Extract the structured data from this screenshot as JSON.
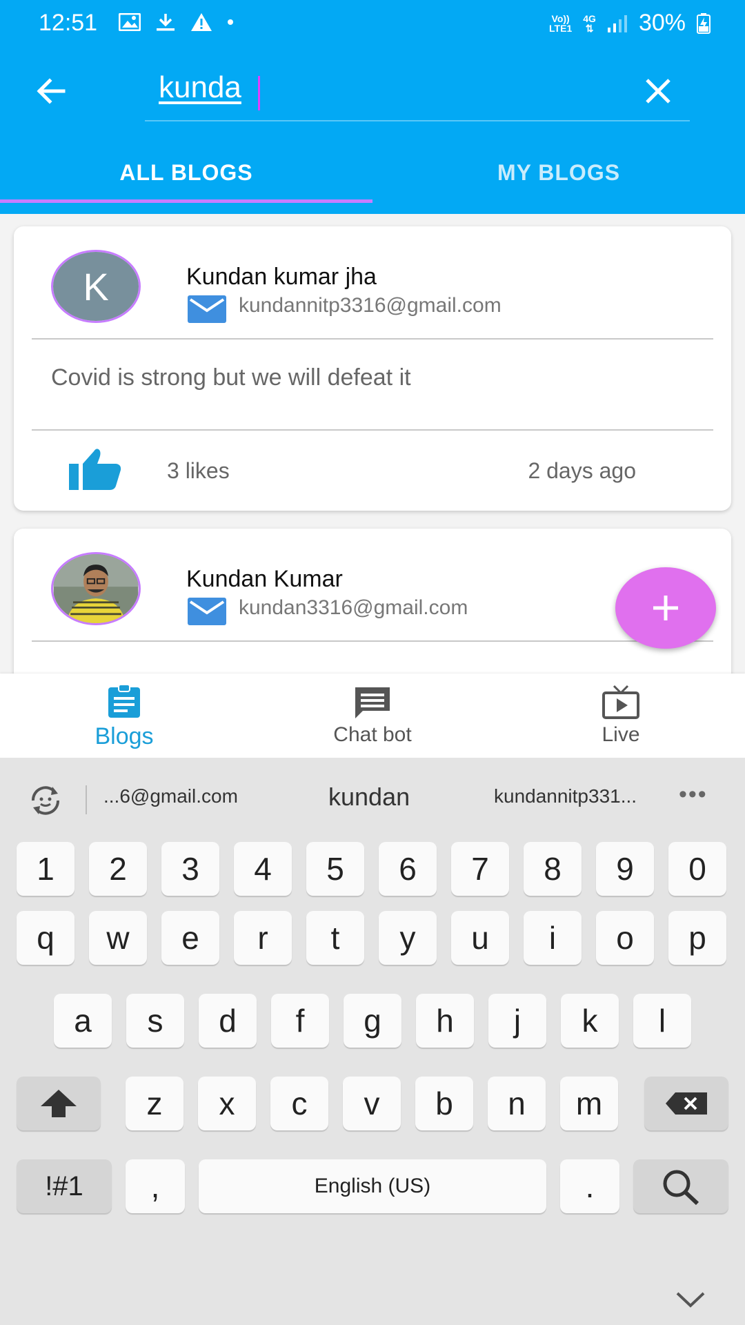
{
  "status_bar": {
    "time": "12:51",
    "battery": "30%",
    "network_top": "Vo))\nLTE1",
    "network_label": "4G"
  },
  "search": {
    "value": "kunda",
    "placeholder": ""
  },
  "tabs": [
    {
      "label": "ALL BLOGS",
      "active": true
    },
    {
      "label": "MY BLOGS",
      "active": false
    }
  ],
  "blogs": [
    {
      "avatar_letter": "K",
      "author": "Kundan kumar jha",
      "email": "kundannitp3316@gmail.com",
      "text": "Covid is strong but we will defeat it",
      "likes": "3 likes",
      "time": "2 days ago"
    },
    {
      "author": "Kundan Kumar",
      "email": "kundan3316@gmail.com"
    }
  ],
  "bottom_nav": [
    {
      "label": "Blogs",
      "icon": "assignment-icon",
      "active": true
    },
    {
      "label": "Chat bot",
      "icon": "chat-icon",
      "active": false
    },
    {
      "label": "Live",
      "icon": "tv-icon",
      "active": false
    }
  ],
  "keyboard": {
    "suggestions": [
      "...6@gmail.com",
      "kundan",
      "kundannitp331..."
    ],
    "more": "•••",
    "row_numbers": [
      "1",
      "2",
      "3",
      "4",
      "5",
      "6",
      "7",
      "8",
      "9",
      "0"
    ],
    "row1": [
      "q",
      "w",
      "e",
      "r",
      "t",
      "y",
      "u",
      "i",
      "o",
      "p"
    ],
    "row2": [
      "a",
      "s",
      "d",
      "f",
      "g",
      "h",
      "j",
      "k",
      "l"
    ],
    "row3": [
      "z",
      "x",
      "c",
      "v",
      "b",
      "n",
      "m"
    ],
    "symbols_key": "!#1",
    "comma_key": ",",
    "space_key": "English (US)",
    "period_key": "."
  },
  "colors": {
    "primary": "#03a9f4",
    "accent": "#e070ee",
    "tab_indicator": "#c77dff",
    "nav_active": "#1a9ed8"
  }
}
